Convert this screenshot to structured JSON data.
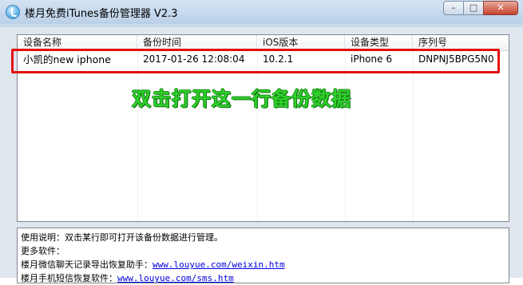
{
  "window": {
    "title": "楼月免费iTunes备份管理器 V2.3",
    "buttons": {
      "minimize": "–",
      "maximize": "□",
      "close": "✕"
    }
  },
  "list": {
    "columns": [
      "设备名称",
      "备份时间",
      "iOS版本",
      "设备类型",
      "序列号"
    ],
    "rows": [
      [
        "小凯的new iphone",
        "2017-01-26 12:08:04",
        "10.2.1",
        "iPhone 6",
        "DNPNJ5BPG5N0"
      ]
    ]
  },
  "annotation": "双击打开这一行备份数据",
  "info": {
    "usage": "使用说明：双击某行即可打开该备份数据进行管理。",
    "more": "更多软件：",
    "wechat_label": "楼月微信聊天记录导出恢复助手：",
    "wechat_link": "www.louyue.com/weixin.htm",
    "sms_label": "楼月手机短信恢复软件：",
    "sms_link": "www.louyue.com/sms.htm"
  },
  "colors": {
    "highlight": "#e30f0f",
    "annotation": "#2ed02a",
    "link": "#0000e0"
  }
}
